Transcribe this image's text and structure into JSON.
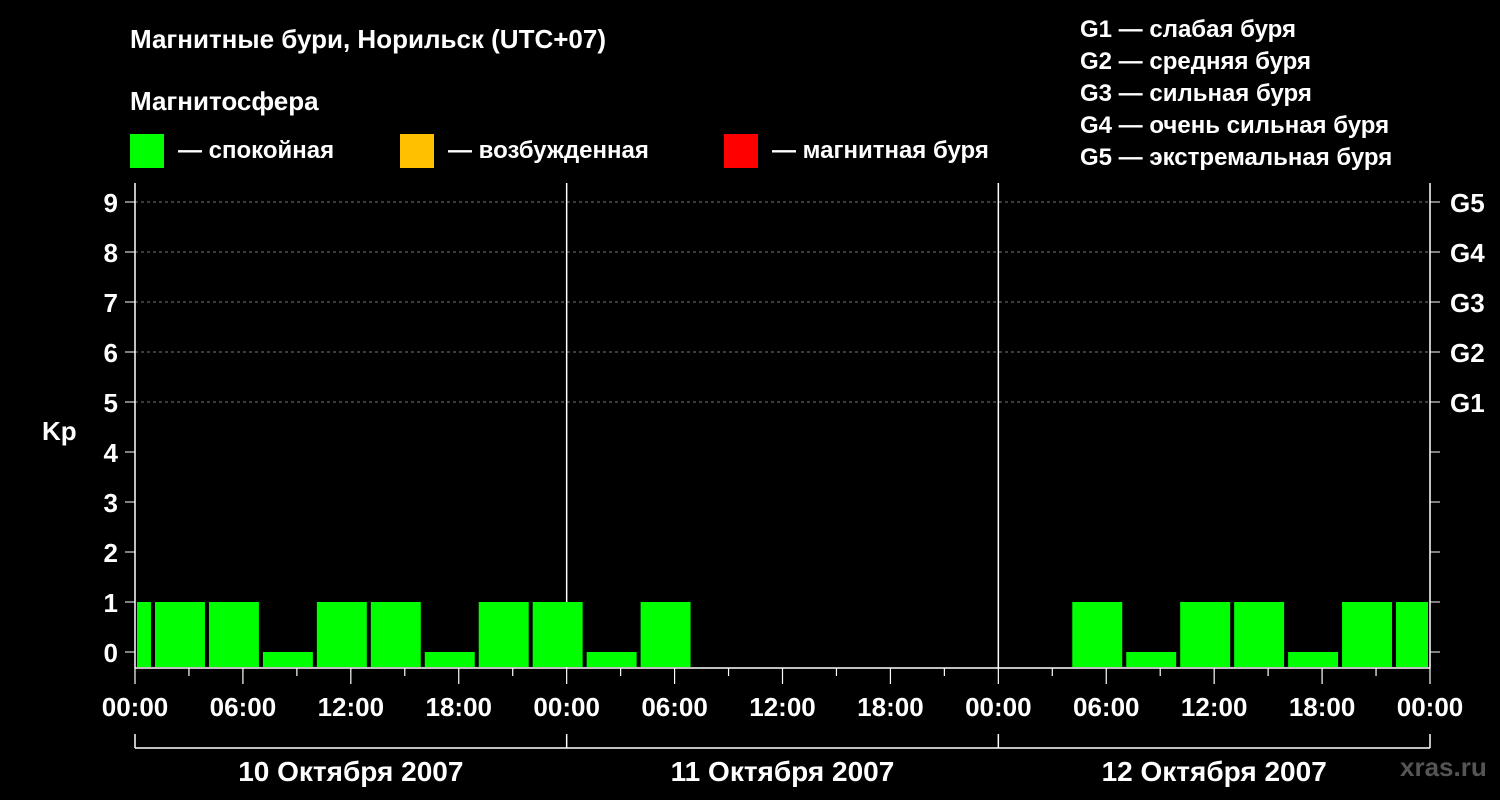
{
  "title": "Магнитные бури, Норильск (UTC+07)",
  "magnetosphere_label": "Магнитосфера",
  "legend": [
    {
      "color": "#00ff00",
      "label": "— спокойная"
    },
    {
      "color": "#ffc000",
      "label": "— возбужденная"
    },
    {
      "color": "#ff0000",
      "label": "— магнитная буря"
    }
  ],
  "g_scale": [
    "G1 — слабая буря",
    "G2 — средняя буря",
    "G3 — сильная буря",
    "G4 — очень сильная буря",
    "G5 — экстремальная буря"
  ],
  "watermark": "xras.ru",
  "chart_data": {
    "type": "bar",
    "ylabel": "Kp",
    "ylim": [
      0,
      9
    ],
    "y_ticks": [
      "0",
      "1",
      "2",
      "3",
      "4",
      "5",
      "6",
      "7",
      "8",
      "9"
    ],
    "right_axis_labels": [
      {
        "kp": 5,
        "label": "G1"
      },
      {
        "kp": 6,
        "label": "G2"
      },
      {
        "kp": 7,
        "label": "G3"
      },
      {
        "kp": 8,
        "label": "G4"
      },
      {
        "kp": 9,
        "label": "G5"
      }
    ],
    "x_tick_labels": [
      "00:00",
      "06:00",
      "12:00",
      "18:00",
      "00:00",
      "06:00",
      "12:00",
      "18:00",
      "00:00",
      "06:00",
      "12:00",
      "18:00",
      "00:00"
    ],
    "days": [
      "10 Октября 2007",
      "11 Октября 2007",
      "12 Октября 2007"
    ],
    "grid": "dashed horizontal at Kp 5-9",
    "bar_hours": 3,
    "series": [
      {
        "values": [
          {
            "start": "10 Октября 2007 00:00",
            "end": "10 Октября 2007 01:00",
            "kp": 1,
            "color": "#00ff00"
          },
          {
            "start": "10 Октября 2007 01:00",
            "end": "10 Октября 2007 04:00",
            "kp": 1,
            "color": "#00ff00"
          },
          {
            "start": "10 Октября 2007 04:00",
            "end": "10 Октября 2007 07:00",
            "kp": 1,
            "color": "#00ff00"
          },
          {
            "start": "10 Октября 2007 07:00",
            "end": "10 Октября 2007 10:00",
            "kp": 0,
            "color": "#00ff00"
          },
          {
            "start": "10 Октября 2007 10:00",
            "end": "10 Октября 2007 13:00",
            "kp": 1,
            "color": "#00ff00"
          },
          {
            "start": "10 Октября 2007 13:00",
            "end": "10 Октября 2007 16:00",
            "kp": 1,
            "color": "#00ff00"
          },
          {
            "start": "10 Октября 2007 16:00",
            "end": "10 Октября 2007 19:00",
            "kp": 0,
            "color": "#00ff00"
          },
          {
            "start": "10 Октября 2007 19:00",
            "end": "10 Октября 2007 22:00",
            "kp": 1,
            "color": "#00ff00"
          },
          {
            "start": "10 Октября 2007 22:00",
            "end": "11 Октября 2007 01:00",
            "kp": 1,
            "color": "#00ff00"
          },
          {
            "start": "11 Октября 2007 01:00",
            "end": "11 Октября 2007 04:00",
            "kp": 0,
            "color": "#00ff00"
          },
          {
            "start": "11 Октября 2007 04:00",
            "end": "11 Октября 2007 07:00",
            "kp": 1,
            "color": "#00ff00"
          },
          {
            "start": "12 Октября 2007 04:00",
            "end": "12 Октября 2007 07:00",
            "kp": 1,
            "color": "#00ff00"
          },
          {
            "start": "12 Октября 2007 07:00",
            "end": "12 Октября 2007 10:00",
            "kp": 0,
            "color": "#00ff00"
          },
          {
            "start": "12 Октября 2007 10:00",
            "end": "12 Октября 2007 13:00",
            "kp": 1,
            "color": "#00ff00"
          },
          {
            "start": "12 Октября 2007 13:00",
            "end": "12 Октября 2007 16:00",
            "kp": 1,
            "color": "#00ff00"
          },
          {
            "start": "12 Октября 2007 16:00",
            "end": "12 Октября 2007 19:00",
            "kp": 0,
            "color": "#00ff00"
          },
          {
            "start": "12 Октября 2007 19:00",
            "end": "12 Октября 2007 22:00",
            "kp": 1,
            "color": "#00ff00"
          },
          {
            "start": "12 Октября 2007 22:00",
            "end": "13 Октября 2007 00:00",
            "kp": 1,
            "color": "#00ff00"
          }
        ]
      }
    ]
  }
}
